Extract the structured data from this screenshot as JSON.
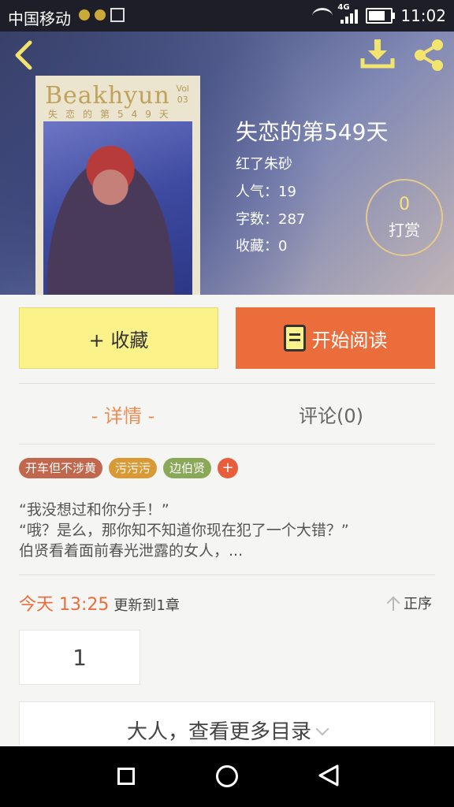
{
  "status_bar": {
    "carrier": "中国移动",
    "network": "4G",
    "time": "11:02"
  },
  "book": {
    "title": "失恋的第549天",
    "author": "红了朱砂",
    "popularity_label": "人气：19",
    "words_label": "字数：287",
    "favorites_label": "收藏：0",
    "cover": {
      "title": "Beakhyun",
      "subtitle": "失恋的第549天",
      "vol": "Vol",
      "vol_num": "03"
    },
    "tip": {
      "count": "0",
      "label": "打赏"
    }
  },
  "actions": {
    "favorite_label": "+ 收藏",
    "read_label": "开始阅读"
  },
  "tabs": {
    "detail": "- 详情 -",
    "comments": "评论(0)"
  },
  "tags": [
    {
      "label": "开车但不涉黄",
      "color": "#c0674d"
    },
    {
      "label": "污污污",
      "color": "#d99a36"
    },
    {
      "label": "边伯贤",
      "color": "#8aa958"
    }
  ],
  "tag_add": "+",
  "summary": [
    "“我没想过和你分手！”",
    "“哦？是么，那你知不知道你现在犯了一个大错？”",
    "伯贤看着面前春光泄露的女人，..."
  ],
  "update": {
    "today": "今天 13:25",
    "text": "更新到1章",
    "order": "正序"
  },
  "chapters": [
    "1"
  ],
  "more_label": "大人，查看更多目录",
  "colors": {
    "accent": "#ec6d3c",
    "favorite_bg": "#fbf28a"
  }
}
